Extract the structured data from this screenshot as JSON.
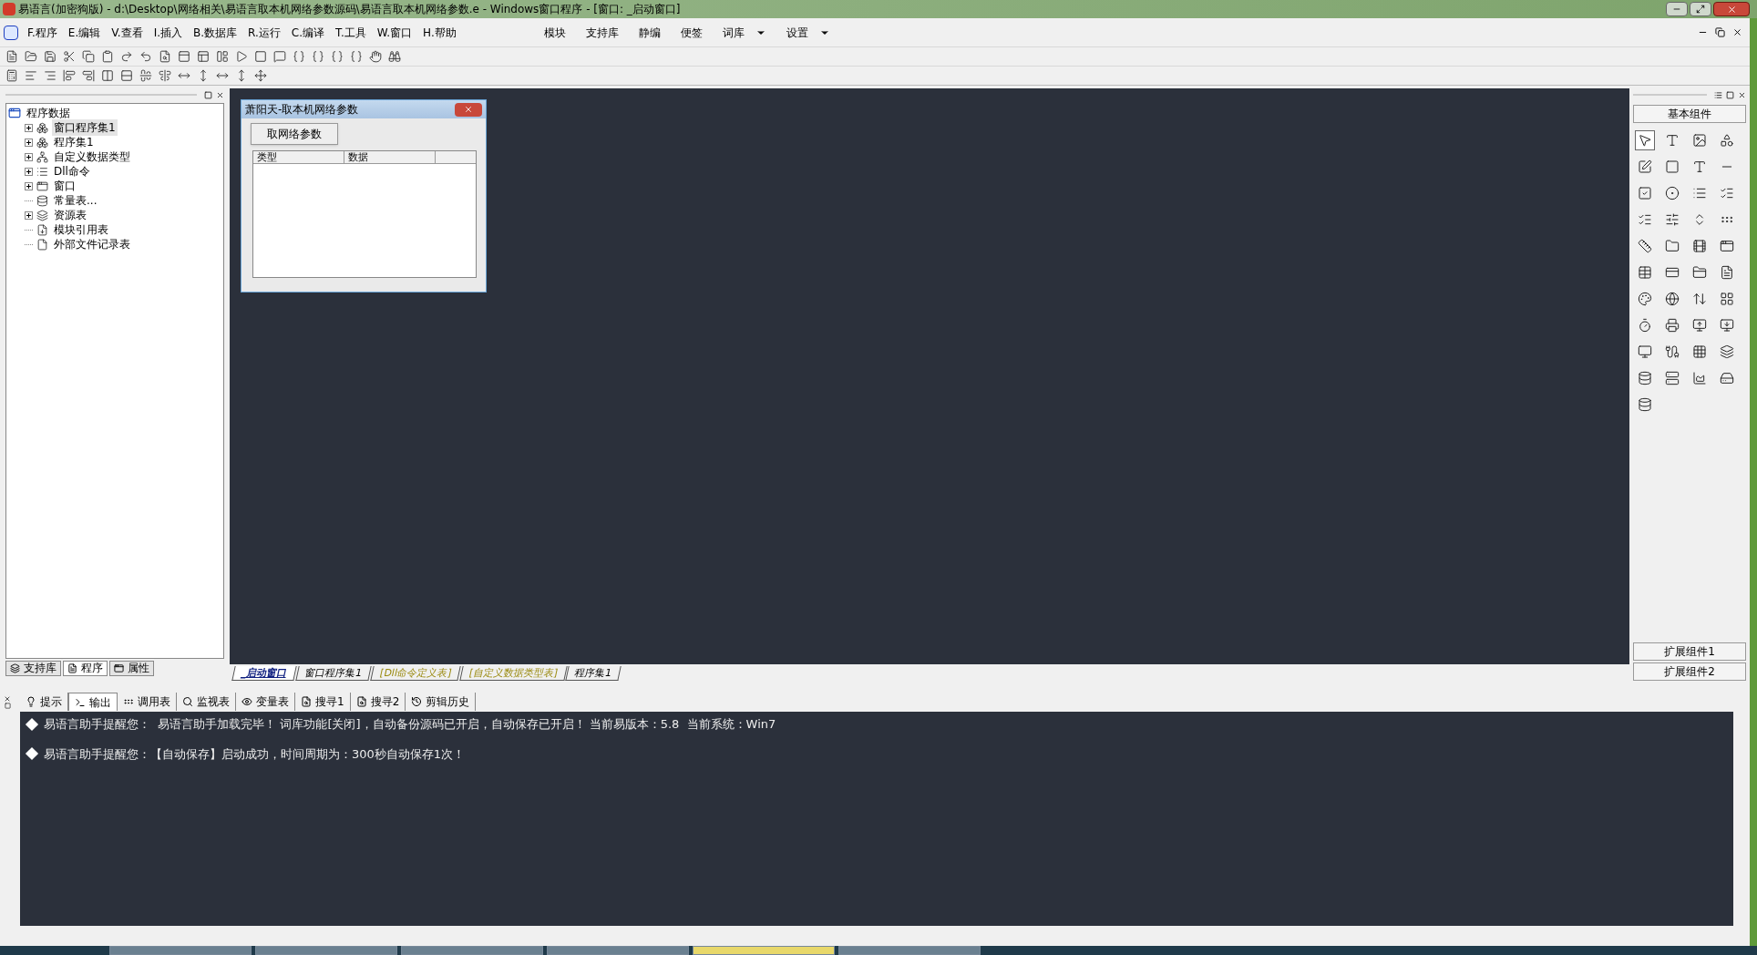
{
  "window": {
    "title": "易语言(加密狗版) - d:\\Desktop\\网络相关\\易语言取本机网络参数源码\\易语言取本机网络参数.e - Windows窗口程序 - [窗口: _启动窗口]"
  },
  "menu": [
    "F.程序",
    "E.编辑",
    "V.查看",
    "I.插入",
    "B.数据库",
    "R.运行",
    "C.编译",
    "T.工具",
    "W.窗口",
    "H.帮助"
  ],
  "menu_right": [
    {
      "label": "模块",
      "dropdown": false
    },
    {
      "label": "支持库",
      "dropdown": false
    },
    {
      "label": "静编",
      "dropdown": false
    },
    {
      "label": "便签",
      "dropdown": false
    },
    {
      "label": "词库",
      "dropdown": true
    },
    {
      "label": "设置",
      "dropdown": true
    }
  ],
  "tree": {
    "items": [
      {
        "label": "程序数据",
        "selected": false,
        "children": [
          {
            "label": "窗口程序集1",
            "expandable": true,
            "selected": true
          },
          {
            "label": "程序集1",
            "expandable": true,
            "selected": false
          },
          {
            "label": "自定义数据类型",
            "expandable": true,
            "selected": false
          },
          {
            "label": "Dll命令",
            "expandable": true,
            "selected": false
          },
          {
            "label": "窗口",
            "expandable": true,
            "selected": false
          },
          {
            "label": "常量表...",
            "expandable": false,
            "selected": false
          },
          {
            "label": "资源表",
            "expandable": true,
            "selected": false
          },
          {
            "label": "模块引用表",
            "expandable": false,
            "selected": false
          },
          {
            "label": "外部文件记录表",
            "expandable": false,
            "selected": false
          }
        ]
      }
    ]
  },
  "left_tabs": [
    {
      "label": "支持库",
      "selected": false
    },
    {
      "label": "程序",
      "selected": true
    },
    {
      "label": "属性",
      "selected": false
    }
  ],
  "designer": {
    "form_title": "萧阳天-取本机网络参数",
    "button": "取网络参数",
    "list_columns": [
      "类型",
      "数据"
    ]
  },
  "doc_tabs": [
    {
      "label": "_启动窗口",
      "selected": true,
      "kind": "window"
    },
    {
      "label": "窗口程序集1",
      "selected": false,
      "kind": "code"
    },
    {
      "label": "[Dll命令定义表]",
      "selected": false,
      "kind": "table"
    },
    {
      "label": "[自定义数据类型表]",
      "selected": false,
      "kind": "table"
    },
    {
      "label": "程序集1",
      "selected": false,
      "kind": "code"
    }
  ],
  "toolbox": {
    "title": "基本组件",
    "extensions": [
      "扩展组件1",
      "扩展组件2"
    ]
  },
  "output_tabs": [
    {
      "label": "提示",
      "selected": false
    },
    {
      "label": "输出",
      "selected": true
    },
    {
      "label": "调用表",
      "selected": false
    },
    {
      "label": "监视表",
      "selected": false
    },
    {
      "label": "变量表",
      "selected": false
    },
    {
      "label": "搜寻1",
      "selected": false
    },
    {
      "label": "搜寻2",
      "selected": false
    },
    {
      "label": "剪辑历史",
      "selected": false
    }
  ],
  "output_lines": [
    "易语言助手提醒您：  易语言助手加载完毕！ 词库功能[关闭]，自动备份源码已开启，自动保存已开启！ 当前易版本：5.8  当前系统：Win7",
    "易语言助手提醒您：【自动保存】启动成功，时间周期为：300秒自动保存1次！"
  ]
}
